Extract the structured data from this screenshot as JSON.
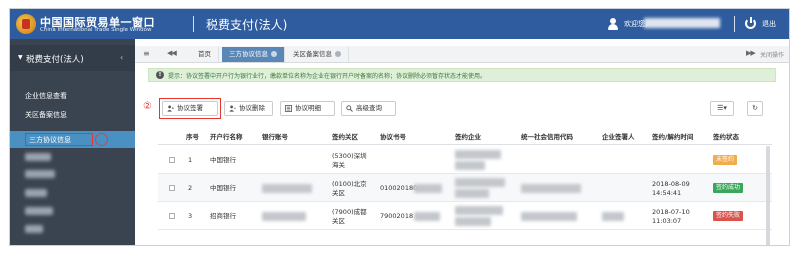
{
  "header": {
    "brand_cn": "中国国际贸易单一窗口",
    "brand_en": "China International Trade Single Window",
    "title": "税费支付(法人)",
    "welcome": "欢迎您,",
    "logout": "退出"
  },
  "sidebar": {
    "section": "税费支付(法人)",
    "items": [
      {
        "label": "企业信息查看"
      },
      {
        "label": "关区备案信息"
      },
      {
        "label": "三方协议信息"
      }
    ]
  },
  "tabs": {
    "items": [
      {
        "label": "首页"
      },
      {
        "label": "三方协议信息"
      },
      {
        "label": "关区备案信息"
      }
    ],
    "close_all": "关闭操作"
  },
  "notice": {
    "icon_text": "!",
    "text": "提示：协议签署中开户行为银行业行，缴款单位名称为企业在银行开户时备案的名称；协议删除必须暂存状态才能使用。"
  },
  "toolbar": {
    "marker": "②",
    "buttons": [
      {
        "label": "协议签署"
      },
      {
        "label": "协议删除"
      },
      {
        "label": "协议明细"
      },
      {
        "label": "高级查询"
      }
    ]
  },
  "table": {
    "headers": [
      "序号",
      "开户行名称",
      "银行账号",
      "签约关区",
      "协议书号",
      "签约企业",
      "统一社会信用代码",
      "企业签署人",
      "签约/解约时间",
      "签约状态"
    ],
    "rows": [
      {
        "no": "1",
        "bank": "中国银行",
        "account": "",
        "customs": "(5300)深圳海关",
        "agreement": "",
        "time": "",
        "status": "未签约",
        "status_color": "#f0ad4e"
      },
      {
        "no": "2",
        "bank": "中国银行",
        "account": "010020180",
        "customs": "(0100)北京关区",
        "agreement": "",
        "time": "2018-08-09 14:54:41",
        "status": "签约成功",
        "status_color": "#3aa65a"
      },
      {
        "no": "3",
        "bank": "招商银行",
        "account": "",
        "customs": "(7900)成都关区",
        "agreement": "79002018",
        "time": "2018-07-10 11:03:07",
        "status": "签约失败",
        "status_color": "#d9534f"
      }
    ]
  }
}
